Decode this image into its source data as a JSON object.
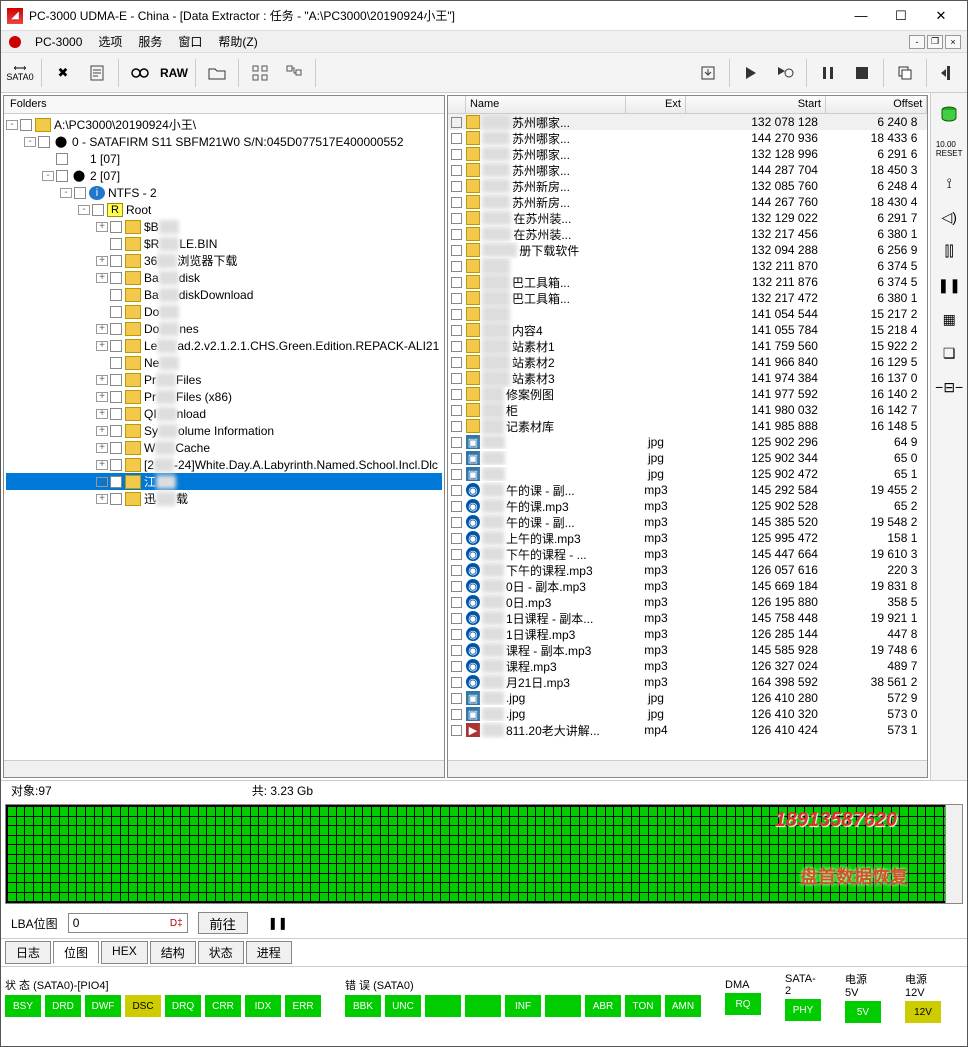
{
  "window": {
    "title": "PC-3000 UDMA-E - China - [Data Extractor : 任务 - \"A:\\PC3000\\20190924小王\"]",
    "app": "PC-3000"
  },
  "menu": [
    "选项",
    "服务",
    "窗口",
    "帮助(Z)"
  ],
  "toolbar": {
    "raw": "RAW"
  },
  "folders_label": "Folders",
  "tree": [
    {
      "d": 0,
      "exp": "-",
      "icon": "folder",
      "txt": "A:\\PC3000\\20190924小王\\"
    },
    {
      "d": 1,
      "exp": "-",
      "icon": "disk",
      "txt": "0 - SATAFIRM  S11 SBFM21W0 S/N:045D077517E400000552"
    },
    {
      "d": 2,
      "exp": "",
      "icon": "none",
      "txt": "1 [07]"
    },
    {
      "d": 2,
      "exp": "-",
      "icon": "disk",
      "txt": "2 [07]"
    },
    {
      "d": 3,
      "exp": "-",
      "icon": "info",
      "txt": "NTFS - 2"
    },
    {
      "d": 4,
      "exp": "-",
      "icon": "root",
      "txt": "Root"
    },
    {
      "d": 5,
      "exp": "+",
      "icon": "folder",
      "pre": "$B",
      "blur": "xx",
      "post": ""
    },
    {
      "d": 5,
      "exp": "",
      "icon": "folder",
      "pre": "$R",
      "blur": "xx",
      "post": "LE.BIN"
    },
    {
      "d": 5,
      "exp": "+",
      "icon": "folder",
      "pre": "36",
      "blur": "xx",
      "post": "浏览器下载"
    },
    {
      "d": 5,
      "exp": "+",
      "icon": "folder",
      "pre": "Ba",
      "blur": "xx",
      "post": "disk"
    },
    {
      "d": 5,
      "exp": "",
      "icon": "folder",
      "pre": "Ba",
      "blur": "xx",
      "post": "diskDownload"
    },
    {
      "d": 5,
      "exp": "",
      "icon": "folder",
      "pre": "Do",
      "blur": "xx",
      "post": ""
    },
    {
      "d": 5,
      "exp": "+",
      "icon": "folder",
      "pre": "Do",
      "blur": "xx",
      "post": "nes"
    },
    {
      "d": 5,
      "exp": "+",
      "icon": "folder",
      "pre": "Le",
      "blur": "xx",
      "post": "ad.2.v2.1.2.1.CHS.Green.Edition.REPACK-ALI21"
    },
    {
      "d": 5,
      "exp": "",
      "icon": "folder",
      "pre": "Ne",
      "blur": "xx",
      "post": ""
    },
    {
      "d": 5,
      "exp": "+",
      "icon": "folder",
      "pre": "Pr",
      "blur": "xx",
      "post": "Files"
    },
    {
      "d": 5,
      "exp": "+",
      "icon": "folder",
      "pre": "Pr",
      "blur": "xx",
      "post": "Files (x86)"
    },
    {
      "d": 5,
      "exp": "+",
      "icon": "folder",
      "pre": "QI",
      "blur": "xx",
      "post": "nload"
    },
    {
      "d": 5,
      "exp": "+",
      "icon": "folder",
      "pre": "Sy",
      "blur": "xx",
      "post": "olume Information"
    },
    {
      "d": 5,
      "exp": "+",
      "icon": "folder",
      "pre": "W",
      "blur": "xx",
      "post": "Cache"
    },
    {
      "d": 5,
      "exp": "+",
      "icon": "folder",
      "pre": "[2",
      "blur": "xx",
      "post": "-24]White.Day.A.Labyrinth.Named.School.Incl.Dlc"
    },
    {
      "d": 5,
      "exp": "+",
      "icon": "folder",
      "pre": "江",
      "blur": "xx",
      "post": "",
      "sel": true
    },
    {
      "d": 5,
      "exp": "+",
      "icon": "folder",
      "pre": "迅",
      "blur": "xx",
      "post": "载"
    }
  ],
  "filehead": {
    "name": "Name",
    "ext": "Ext",
    "start": "Start",
    "offset": "Offset"
  },
  "files": [
    {
      "i": "fld",
      "blur": "xxxx",
      "nm": "苏州哪家...",
      "ext": "",
      "st": "132 078 128",
      "off": "6 240 8",
      "top": true
    },
    {
      "i": "fld",
      "blur": "xxxx",
      "nm": "苏州哪家...",
      "ext": "",
      "st": "144 270 936",
      "off": "18 433 6"
    },
    {
      "i": "fld",
      "blur": "xxxx",
      "nm": "苏州哪家...",
      "ext": "",
      "st": "132 128 996",
      "off": "6 291 6"
    },
    {
      "i": "fld",
      "blur": "xxxx",
      "nm": "苏州哪家...",
      "ext": "",
      "st": "144 287 704",
      "off": "18 450 3"
    },
    {
      "i": "fld",
      "blur": "xxxx",
      "nm": "苏州新房...",
      "ext": "",
      "st": "132 085 760",
      "off": "6 248 4"
    },
    {
      "i": "fld",
      "blur": "xxxx",
      "nm": "苏州新房...",
      "ext": "",
      "st": "144 267 760",
      "off": "18 430 4"
    },
    {
      "i": "fld",
      "blur": "20xx",
      "nm": "在苏州装...",
      "ext": "",
      "st": "132 129 022",
      "off": "6 291 7"
    },
    {
      "i": "fld",
      "blur": "20xx",
      "nm": "在苏州装...",
      "ext": "",
      "st": "132 217 456",
      "off": "6 380 1"
    },
    {
      "i": "fld",
      "blur": "QQ3x",
      "nm": "册下载软件",
      "ext": "",
      "st": "132 094 288",
      "off": "6 256 9"
    },
    {
      "i": "fld",
      "blur": "作图",
      "nm": "",
      "ext": "",
      "st": "132 211 870",
      "off": "6 374 5"
    },
    {
      "i": "fld",
      "blur": "发发",
      "nm": "巴工具箱...",
      "ext": "",
      "st": "132 211 876",
      "off": "6 374 5"
    },
    {
      "i": "fld",
      "blur": "发发",
      "nm": "巴工具箱...",
      "ext": "",
      "st": "132 217 472",
      "off": "6 380 1"
    },
    {
      "i": "fld",
      "blur": "图标",
      "nm": "",
      "ext": "",
      "st": "141 054 544",
      "off": "15 217 2"
    },
    {
      "i": "fld",
      "blur": "每xx",
      "nm": "内容4",
      "ext": "",
      "st": "141 055 784",
      "off": "15 218 4"
    },
    {
      "i": "fld",
      "blur": "每xx",
      "nm": "站素材1",
      "ext": "",
      "st": "141 759 560",
      "off": "15 922 2"
    },
    {
      "i": "fld",
      "blur": "每xx",
      "nm": "站素材2",
      "ext": "",
      "st": "141 966 840",
      "off": "16 129 5"
    },
    {
      "i": "fld",
      "blur": "每xx",
      "nm": "站素材3",
      "ext": "",
      "st": "141 974 384",
      "off": "16 137 0"
    },
    {
      "i": "fld",
      "blur": "毛x",
      "nm": "修案例图",
      "ext": "",
      "st": "141 977 592",
      "off": "16 140 2"
    },
    {
      "i": "fld",
      "blur": "硬x",
      "nm": "柜",
      "ext": "",
      "st": "141 980 032",
      "off": "16 142 7"
    },
    {
      "i": "fld",
      "blur": "装x",
      "nm": "记素材库",
      "ext": "",
      "st": "141 985 888",
      "off": "16 148 5"
    },
    {
      "i": "img",
      "blur": "1xx",
      "nm": "",
      "ext": "jpg",
      "st": "125 902 296",
      "off": "64 9"
    },
    {
      "i": "img",
      "blur": "1xx",
      "nm": "",
      "ext": "jpg",
      "st": "125 902 344",
      "off": "65 0"
    },
    {
      "i": "img",
      "blur": "1xx",
      "nm": "",
      "ext": "jpg",
      "st": "125 902 472",
      "off": "65 1"
    },
    {
      "i": "aud",
      "blur": "xxx",
      "nm": "午的课 - 副...",
      "ext": "mp3",
      "st": "145 292 584",
      "off": "19 455 2"
    },
    {
      "i": "aud",
      "blur": "xxx",
      "nm": "午的课.mp3",
      "ext": "mp3",
      "st": "125 902 528",
      "off": "65 2"
    },
    {
      "i": "aud",
      "blur": "xxx",
      "nm": "午的课 - 副...",
      "ext": "mp3",
      "st": "145 385 520",
      "off": "19 548 2"
    },
    {
      "i": "aud",
      "blur": "xxx",
      "nm": "上午的课.mp3",
      "ext": "mp3",
      "st": "125 995 472",
      "off": "158 1"
    },
    {
      "i": "aud",
      "blur": "xxx",
      "nm": "下午的课程 - ...",
      "ext": "mp3",
      "st": "145 447 664",
      "off": "19 610 3"
    },
    {
      "i": "aud",
      "blur": "xxx",
      "nm": "下午的课程.mp3",
      "ext": "mp3",
      "st": "126 057 616",
      "off": "220 3"
    },
    {
      "i": "aud",
      "blur": "xxx",
      "nm": "0日 - 副本.mp3",
      "ext": "mp3",
      "st": "145 669 184",
      "off": "19 831 8"
    },
    {
      "i": "aud",
      "blur": "xxx",
      "nm": "0日.mp3",
      "ext": "mp3",
      "st": "126 195 880",
      "off": "358 5"
    },
    {
      "i": "aud",
      "blur": "xxx",
      "nm": "1日课程 - 副本...",
      "ext": "mp3",
      "st": "145 758 448",
      "off": "19 921 1"
    },
    {
      "i": "aud",
      "blur": "xxx",
      "nm": "1日课程.mp3",
      "ext": "mp3",
      "st": "126 285 144",
      "off": "447 8"
    },
    {
      "i": "aud",
      "blur": "xxx",
      "nm": "课程 - 副本.mp3",
      "ext": "mp3",
      "st": "145 585 928",
      "off": "19 748 6"
    },
    {
      "i": "aud",
      "blur": "xxx",
      "nm": "课程.mp3",
      "ext": "mp3",
      "st": "126 327 024",
      "off": "489 7"
    },
    {
      "i": "aud",
      "blur": "xxx",
      "nm": "月21日.mp3",
      "ext": "mp3",
      "st": "164 398 592",
      "off": "38 561 2"
    },
    {
      "i": "img",
      "blur": "xxx",
      "nm": ".jpg",
      "ext": "jpg",
      "st": "126 410 280",
      "off": "572 9"
    },
    {
      "i": "img",
      "blur": "xxx",
      "nm": ".jpg",
      "ext": "jpg",
      "st": "126 410 320",
      "off": "573 0"
    },
    {
      "i": "vid",
      "blur": "xxx",
      "nm": "811.20老大讲解...",
      "ext": "mp4",
      "st": "126 410 424",
      "off": "573 1"
    }
  ],
  "status": {
    "objects": "对象:97",
    "total": "共:   3.23 Gb"
  },
  "lba": {
    "label": "LBA位图",
    "value": "0",
    "go": "前往"
  },
  "tabs": [
    "日志",
    "位图",
    "HEX",
    "结构",
    "状态",
    "进程"
  ],
  "hw": {
    "status_label": "状 态 (SATA0)-[PIO4]",
    "status": [
      "BSY",
      "DRD",
      "DWF",
      "DSC",
      "DRQ",
      "CRR",
      "IDX",
      "ERR"
    ],
    "err_label": "错 误 (SATA0)",
    "err": [
      "BBK",
      "UNC",
      "",
      "",
      "INF",
      "",
      "ABR",
      "TON",
      "AMN"
    ],
    "dma_label": "DMA",
    "dma": [
      "RQ"
    ],
    "sata_label": "SATA-2",
    "sata": [
      "PHY"
    ],
    "pwr5_label": "电源 5V",
    "pwr5": [
      "5V"
    ],
    "pwr12_label": "电源 12V",
    "pwr12": [
      "12V"
    ]
  },
  "watermark": "盘首数据恢复",
  "phone": "18913587620"
}
